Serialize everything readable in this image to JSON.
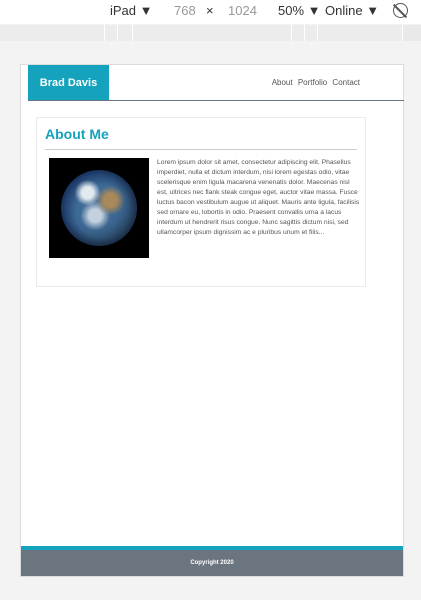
{
  "devtools": {
    "device": "iPad ▼",
    "width": "768",
    "times": "×",
    "height": "1024",
    "zoom": "50% ▼",
    "network": "Online ▼"
  },
  "site": {
    "brand": "Brad Davis",
    "nav": [
      "About",
      "Portfolio",
      "Contact"
    ],
    "about": {
      "title": "About Me",
      "body": "Lorem ipsum dolor sit amet, consectetur adipiscing elit. Phasellus imperdiet, nulla et dictum interdum, nisi lorem egestas odio, vitae scelerisque enim ligula macarena venenatis dolor. Maecenas nisl est, ultrices nec flank steak congue eget, auctor vitae massa. Fusce luctus bacon vestibulum augue ut aliquet. Mauris ante ligula, facilisis sed ornare eu, lobortis in odio. Praesent convallis urna a lacus interdum ut hendrerit risus congue. Nunc sagittis dictum nisi, sed ullamcorper ipsum dignissim ac e pluribus unum et filis..."
    },
    "footer": "Copyright 2020"
  },
  "colors": {
    "accent": "#14a2bc",
    "footer_bg": "#6b7580"
  }
}
